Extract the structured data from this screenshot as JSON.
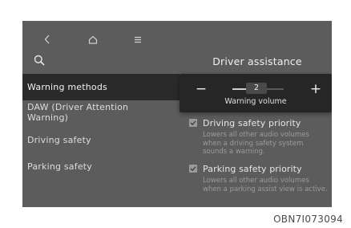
{
  "header": {
    "title": "Driver assistance",
    "nav_icons": [
      "back-icon",
      "home-icon",
      "menu-icon"
    ],
    "search_icon": "search-icon"
  },
  "sidebar": {
    "items": [
      {
        "label": "Warning methods",
        "active": true
      },
      {
        "label": "DAW (Driver Attention Warning)",
        "active": false
      },
      {
        "label": "Driving safety",
        "active": false
      },
      {
        "label": "Parking safety",
        "active": false
      }
    ]
  },
  "volume_popup": {
    "minus_label": "−",
    "plus_label": "+",
    "value": "2",
    "level_fraction": 0.4,
    "label": "Warning volume"
  },
  "options": [
    {
      "title": "Driving safety priority",
      "description": "Lowers all other audio volumes when a driving safety system sounds a warning.",
      "checked": true
    },
    {
      "title": "Parking safety priority",
      "description": "Lowers all other audio volumes when a parking assist view is active.",
      "checked": true
    }
  ],
  "figure_code": "OBN7I073094",
  "colors": {
    "screen_bg": "#5c5c5c",
    "active_item_bg": "#2a2a2a",
    "popup_bg": "#262626"
  }
}
